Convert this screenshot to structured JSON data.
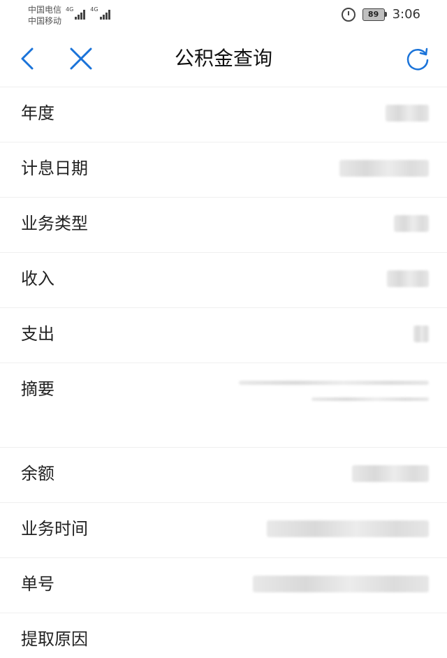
{
  "status_bar": {
    "carrier_1": "中国电信",
    "carrier_2": "中国移动",
    "network_1": "4G",
    "network_2": "4G",
    "battery": "89",
    "time": "3:06",
    "icons": [
      "signal-icon",
      "alarm-icon",
      "battery-icon"
    ]
  },
  "nav": {
    "title": "公积金查询",
    "back_icon": "chevron-left-icon",
    "close_icon": "close-icon",
    "refresh_icon": "refresh-icon",
    "accent_color": "#1a73d9"
  },
  "rows": [
    {
      "label": "年度"
    },
    {
      "label": "计息日期"
    },
    {
      "label": "业务类型"
    },
    {
      "label": "收入"
    },
    {
      "label": "支出"
    },
    {
      "label": "摘要"
    },
    {
      "label": "余额"
    },
    {
      "label": "业务时间"
    },
    {
      "label": "单号"
    },
    {
      "label": "提取原因"
    }
  ]
}
